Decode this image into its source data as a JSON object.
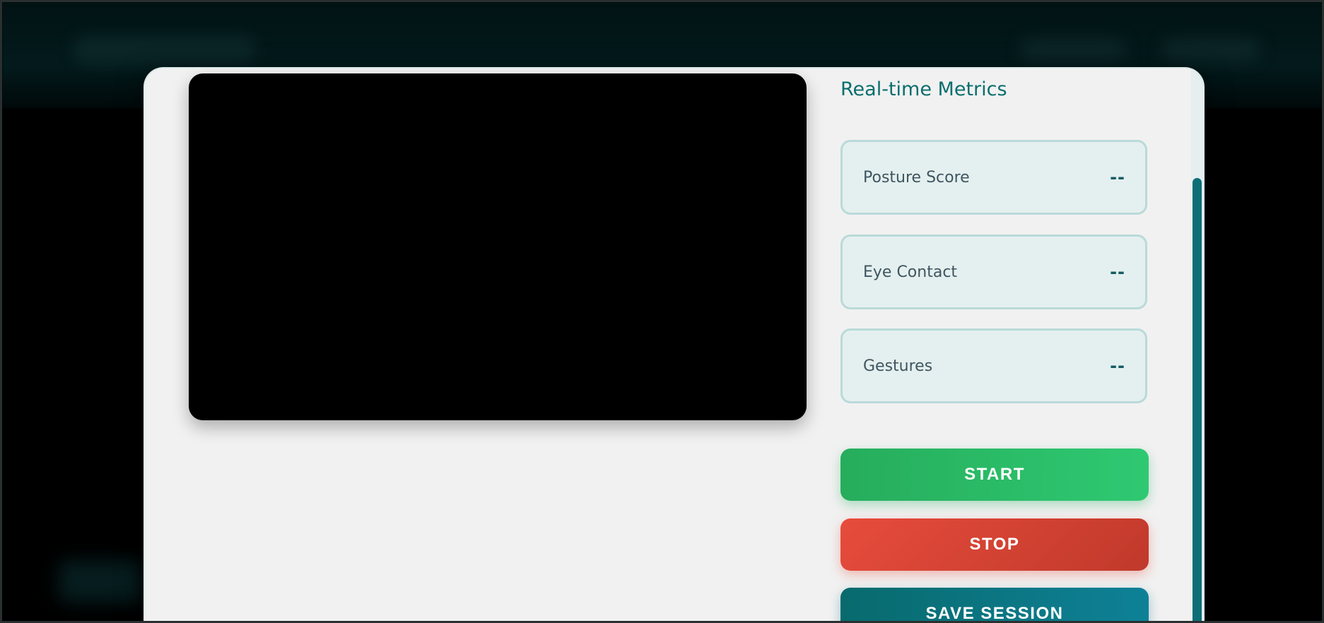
{
  "metrics": {
    "title": "Real-time Metrics",
    "items": [
      {
        "label": "Posture Score",
        "value": "--"
      },
      {
        "label": "Eye Contact",
        "value": "--"
      },
      {
        "label": "Gestures",
        "value": "--"
      }
    ]
  },
  "controls": {
    "start_label": "START",
    "stop_label": "STOP",
    "save_label": "SAVE SESSION"
  },
  "colors": {
    "accent": "#0b6e6e",
    "start": "#2ecc71",
    "stop": "#e74c3c",
    "save": "#0e8197",
    "modal_bg": "#f1f1f1"
  }
}
